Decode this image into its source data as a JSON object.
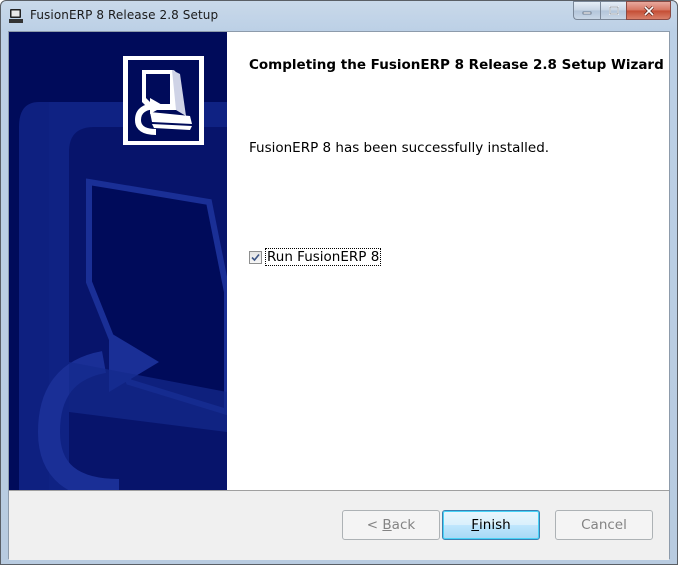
{
  "window": {
    "title": "FusionERP 8 Release 2.8 Setup",
    "app_icon": "computer-setup-icon",
    "caption_buttons": [
      "minimize-icon",
      "maximize-icon",
      "close-icon"
    ]
  },
  "side_panel": {
    "background_color": "#000b5a",
    "logo_icon": "installer-computer-icon"
  },
  "content": {
    "heading": "Completing the FusionERP 8 Release 2.8 Setup Wizard",
    "message": "FusionERP 8 has been successfully installed.",
    "run_checkbox": {
      "label": "Run FusionERP 8",
      "checked": true
    }
  },
  "footer": {
    "back_label_accel": "B",
    "back_label_prefix": "< ",
    "back_label_rest": "ack",
    "back_enabled": false,
    "finish_label_accel": "F",
    "finish_label_rest": "inish",
    "finish_enabled": true,
    "cancel_label": "Cancel",
    "cancel_enabled": false
  }
}
